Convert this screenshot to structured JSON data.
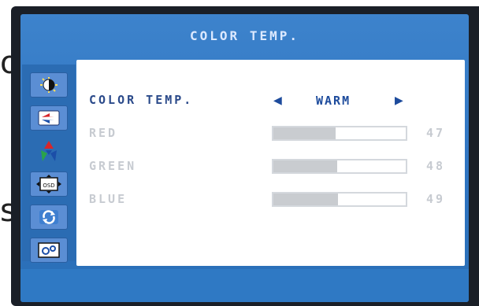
{
  "title": "COLOR TEMP.",
  "sidebar": {
    "items": [
      {
        "icon": "brightness-contrast-icon"
      },
      {
        "icon": "image-setup-icon"
      },
      {
        "icon": "color-temp-icon",
        "active": true
      },
      {
        "icon": "osd-setup-icon"
      },
      {
        "icon": "reset-icon"
      },
      {
        "icon": "extra-settings-icon"
      }
    ]
  },
  "rows": {
    "color_temp": {
      "label": "COLOR TEMP.",
      "value": "WARM"
    },
    "red": {
      "label": "RED",
      "value": "47"
    },
    "green": {
      "label": "GREEN",
      "value": "48"
    },
    "blue": {
      "label": "BLUE",
      "value": "49"
    }
  },
  "background": {
    "top_glyph": "o",
    "bottom_glyph": "s"
  },
  "colors": {
    "osd_blue": "#2e73c0",
    "selected_text": "#2b4a8a",
    "disabled_text": "#c7cbd1"
  }
}
